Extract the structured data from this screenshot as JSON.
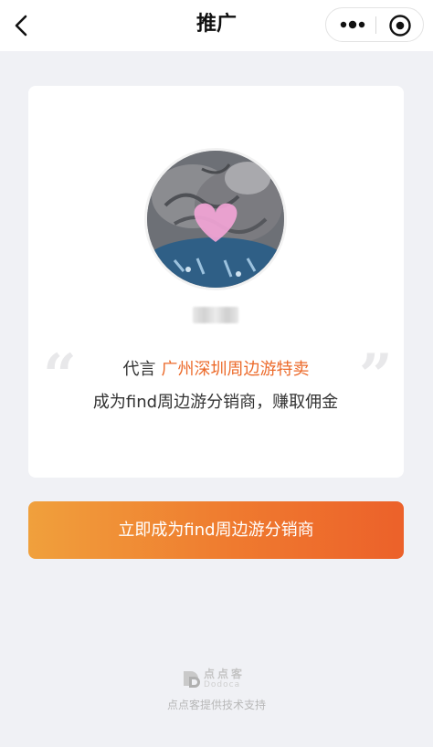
{
  "nav": {
    "title": "推广",
    "back_icon": "chevron-left-icon",
    "more_icon": "more-dots-icon",
    "close_icon": "target-circle-icon"
  },
  "card": {
    "endorse_prefix": "代言",
    "endorse_name": "广州深圳周边游特卖",
    "description": "成为find周边游分销商，赚取佣金",
    "avatar_icon": "avatar-cats-image",
    "quote_left": "“",
    "quote_right": "”"
  },
  "cta": {
    "label": "立即成为find周边游分销商"
  },
  "footer": {
    "brand": "点点客",
    "brand_sub": "Dodoca",
    "support_text": "点点客提供技术支持"
  },
  "colors": {
    "accent": "#ec6a2a",
    "cta_start": "#f0a03c",
    "cta_end": "#ec612a",
    "background": "#f0f1f5"
  }
}
